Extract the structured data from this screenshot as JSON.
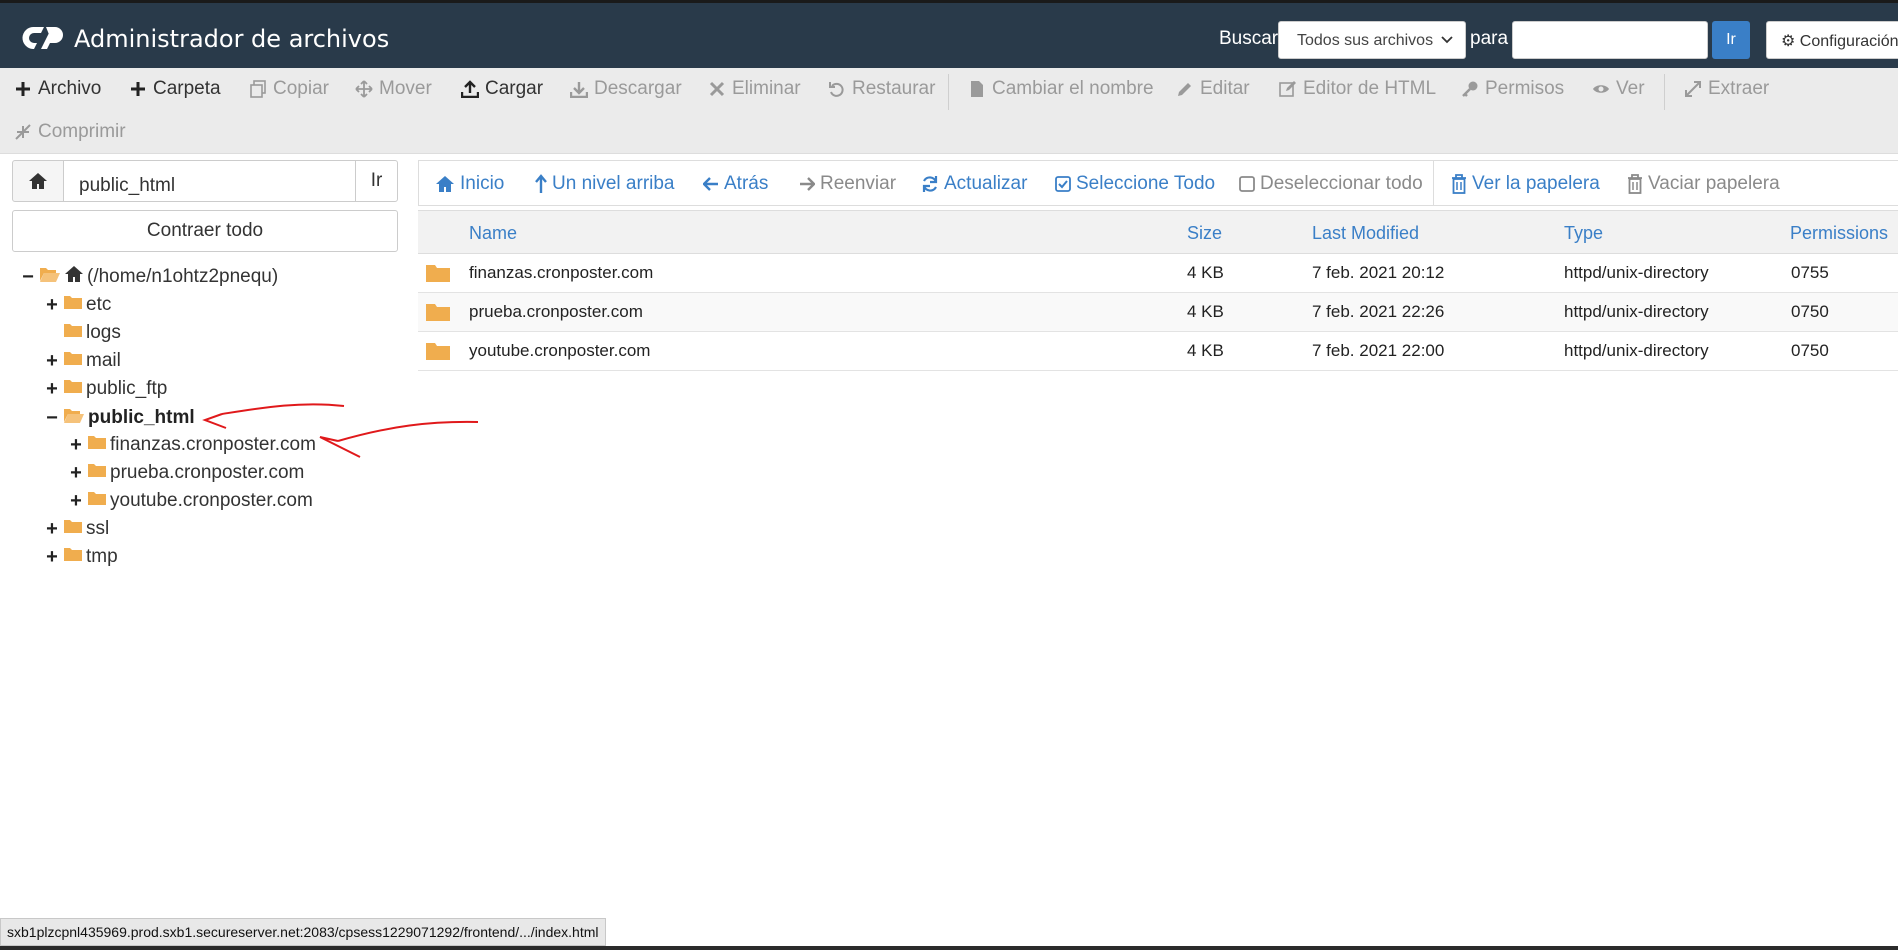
{
  "header": {
    "title": "Administrador de archivos",
    "search_label": "Buscar",
    "search_scope": "Todos sus archivos",
    "search_for_label": "para",
    "search_placeholder": "",
    "search_go": "Ir",
    "settings": "Configuración"
  },
  "toolbar": {
    "row1": [
      {
        "label": "Archivo",
        "icon": "plus-icon",
        "enabled": true
      },
      {
        "label": "Carpeta",
        "icon": "plus-icon",
        "enabled": true
      },
      {
        "label": "Copiar",
        "icon": "copy-icon",
        "enabled": false
      },
      {
        "label": "Mover",
        "icon": "move-icon",
        "enabled": false
      },
      {
        "label": "Cargar",
        "icon": "upload-icon",
        "enabled": true
      },
      {
        "label": "Descargar",
        "icon": "download-icon",
        "enabled": false
      },
      {
        "label": "Eliminar",
        "icon": "times-icon",
        "enabled": false
      },
      {
        "label": "Restaurar",
        "icon": "undo-icon",
        "enabled": false
      },
      {
        "label": "Cambiar el nombre",
        "icon": "file-icon",
        "enabled": false
      },
      {
        "label": "Editar",
        "icon": "pencil-icon",
        "enabled": false
      },
      {
        "label": "Editor de HTML",
        "icon": "edit-icon",
        "enabled": false
      },
      {
        "label": "Permisos",
        "icon": "key-icon",
        "enabled": false
      },
      {
        "label": "Ver",
        "icon": "eye-icon",
        "enabled": false
      },
      {
        "label": "Extraer",
        "icon": "expand-icon",
        "enabled": false
      }
    ],
    "row2": [
      {
        "label": "Comprimir",
        "icon": "compress-icon",
        "enabled": false
      }
    ]
  },
  "left_panel": {
    "path_value": "public_html",
    "path_go": "Ir",
    "collapse_all": "Contraer todo",
    "tree": [
      {
        "label": "(/home/n1ohtz2pnequ)",
        "toggle": "−",
        "level": 0,
        "root": true
      },
      {
        "label": "etc",
        "toggle": "+",
        "level": 1
      },
      {
        "label": "logs",
        "toggle": "",
        "level": 1
      },
      {
        "label": "mail",
        "toggle": "+",
        "level": 1
      },
      {
        "label": "public_ftp",
        "toggle": "+",
        "level": 1
      },
      {
        "label": "public_html",
        "toggle": "−",
        "level": 1,
        "current": true
      },
      {
        "label": "finanzas.cronposter.com",
        "toggle": "+",
        "level": 2
      },
      {
        "label": "prueba.cronposter.com",
        "toggle": "+",
        "level": 2
      },
      {
        "label": "youtube.cronposter.com",
        "toggle": "+",
        "level": 2
      },
      {
        "label": "ssl",
        "toggle": "+",
        "level": 1
      },
      {
        "label": "tmp",
        "toggle": "+",
        "level": 1
      }
    ]
  },
  "nav": [
    {
      "label": "Inicio",
      "icon": "home-icon",
      "enabled": true
    },
    {
      "label": "Un nivel arriba",
      "icon": "level-up-icon",
      "enabled": true
    },
    {
      "label": "Atrás",
      "icon": "arrow-left-icon",
      "enabled": true
    },
    {
      "label": "Reenviar",
      "icon": "arrow-right-icon",
      "enabled": false
    },
    {
      "label": "Actualizar",
      "icon": "refresh-icon",
      "enabled": true
    },
    {
      "label": "Seleccione Todo",
      "icon": "check-square-icon",
      "enabled": true
    },
    {
      "label": "Deseleccionar todo",
      "icon": "square-icon",
      "enabled": false
    },
    {
      "label": "Ver la papelera",
      "icon": "trash-icon",
      "enabled": true
    },
    {
      "label": "Vaciar papelera",
      "icon": "trash-icon",
      "enabled": false
    }
  ],
  "files": {
    "columns": [
      "Name",
      "Size",
      "Last Modified",
      "Type",
      "Permissions"
    ],
    "rows": [
      {
        "name": "finanzas.cronposter.com",
        "size": "4 KB",
        "modified": "7 feb. 2021 20:12",
        "type": "httpd/unix-directory",
        "perms": "0755"
      },
      {
        "name": "prueba.cronposter.com",
        "size": "4 KB",
        "modified": "7 feb. 2021 22:26",
        "type": "httpd/unix-directory",
        "perms": "0750"
      },
      {
        "name": "youtube.cronposter.com",
        "size": "4 KB",
        "modified": "7 feb. 2021 22:00",
        "type": "httpd/unix-directory",
        "perms": "0750"
      }
    ]
  },
  "status_url": "sxb1plzcpnl435969.prod.sxb1.secureserver.net:2083/cpsess1229071292/frontend/.../index.html",
  "colors": {
    "header_bg": "#293a4a",
    "accent": "#3a7fc7",
    "folder": "#f0ad4e",
    "annotation": "#e0191b"
  }
}
